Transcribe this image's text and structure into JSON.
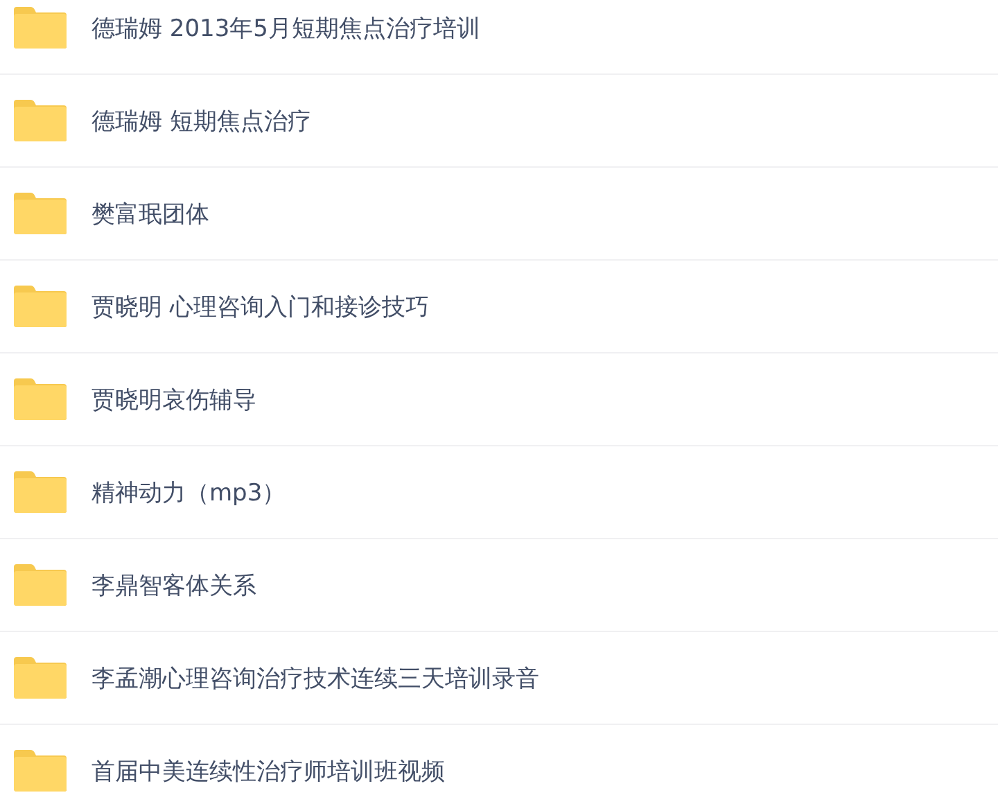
{
  "folders": [
    {
      "name": "德瑞姆 2013年5月短期焦点治疗培训"
    },
    {
      "name": "德瑞姆 短期焦点治疗"
    },
    {
      "name": "樊富珉团体"
    },
    {
      "name": "贾晓明 心理咨询入门和接诊技巧"
    },
    {
      "name": "贾晓明哀伤辅导"
    },
    {
      "name": "精神动力（mp3）"
    },
    {
      "name": "李鼎智客体关系"
    },
    {
      "name": "李孟潮心理咨询治疗技术连续三天培训录音"
    },
    {
      "name": "首届中美连续性治疗师培训班视频"
    }
  ]
}
